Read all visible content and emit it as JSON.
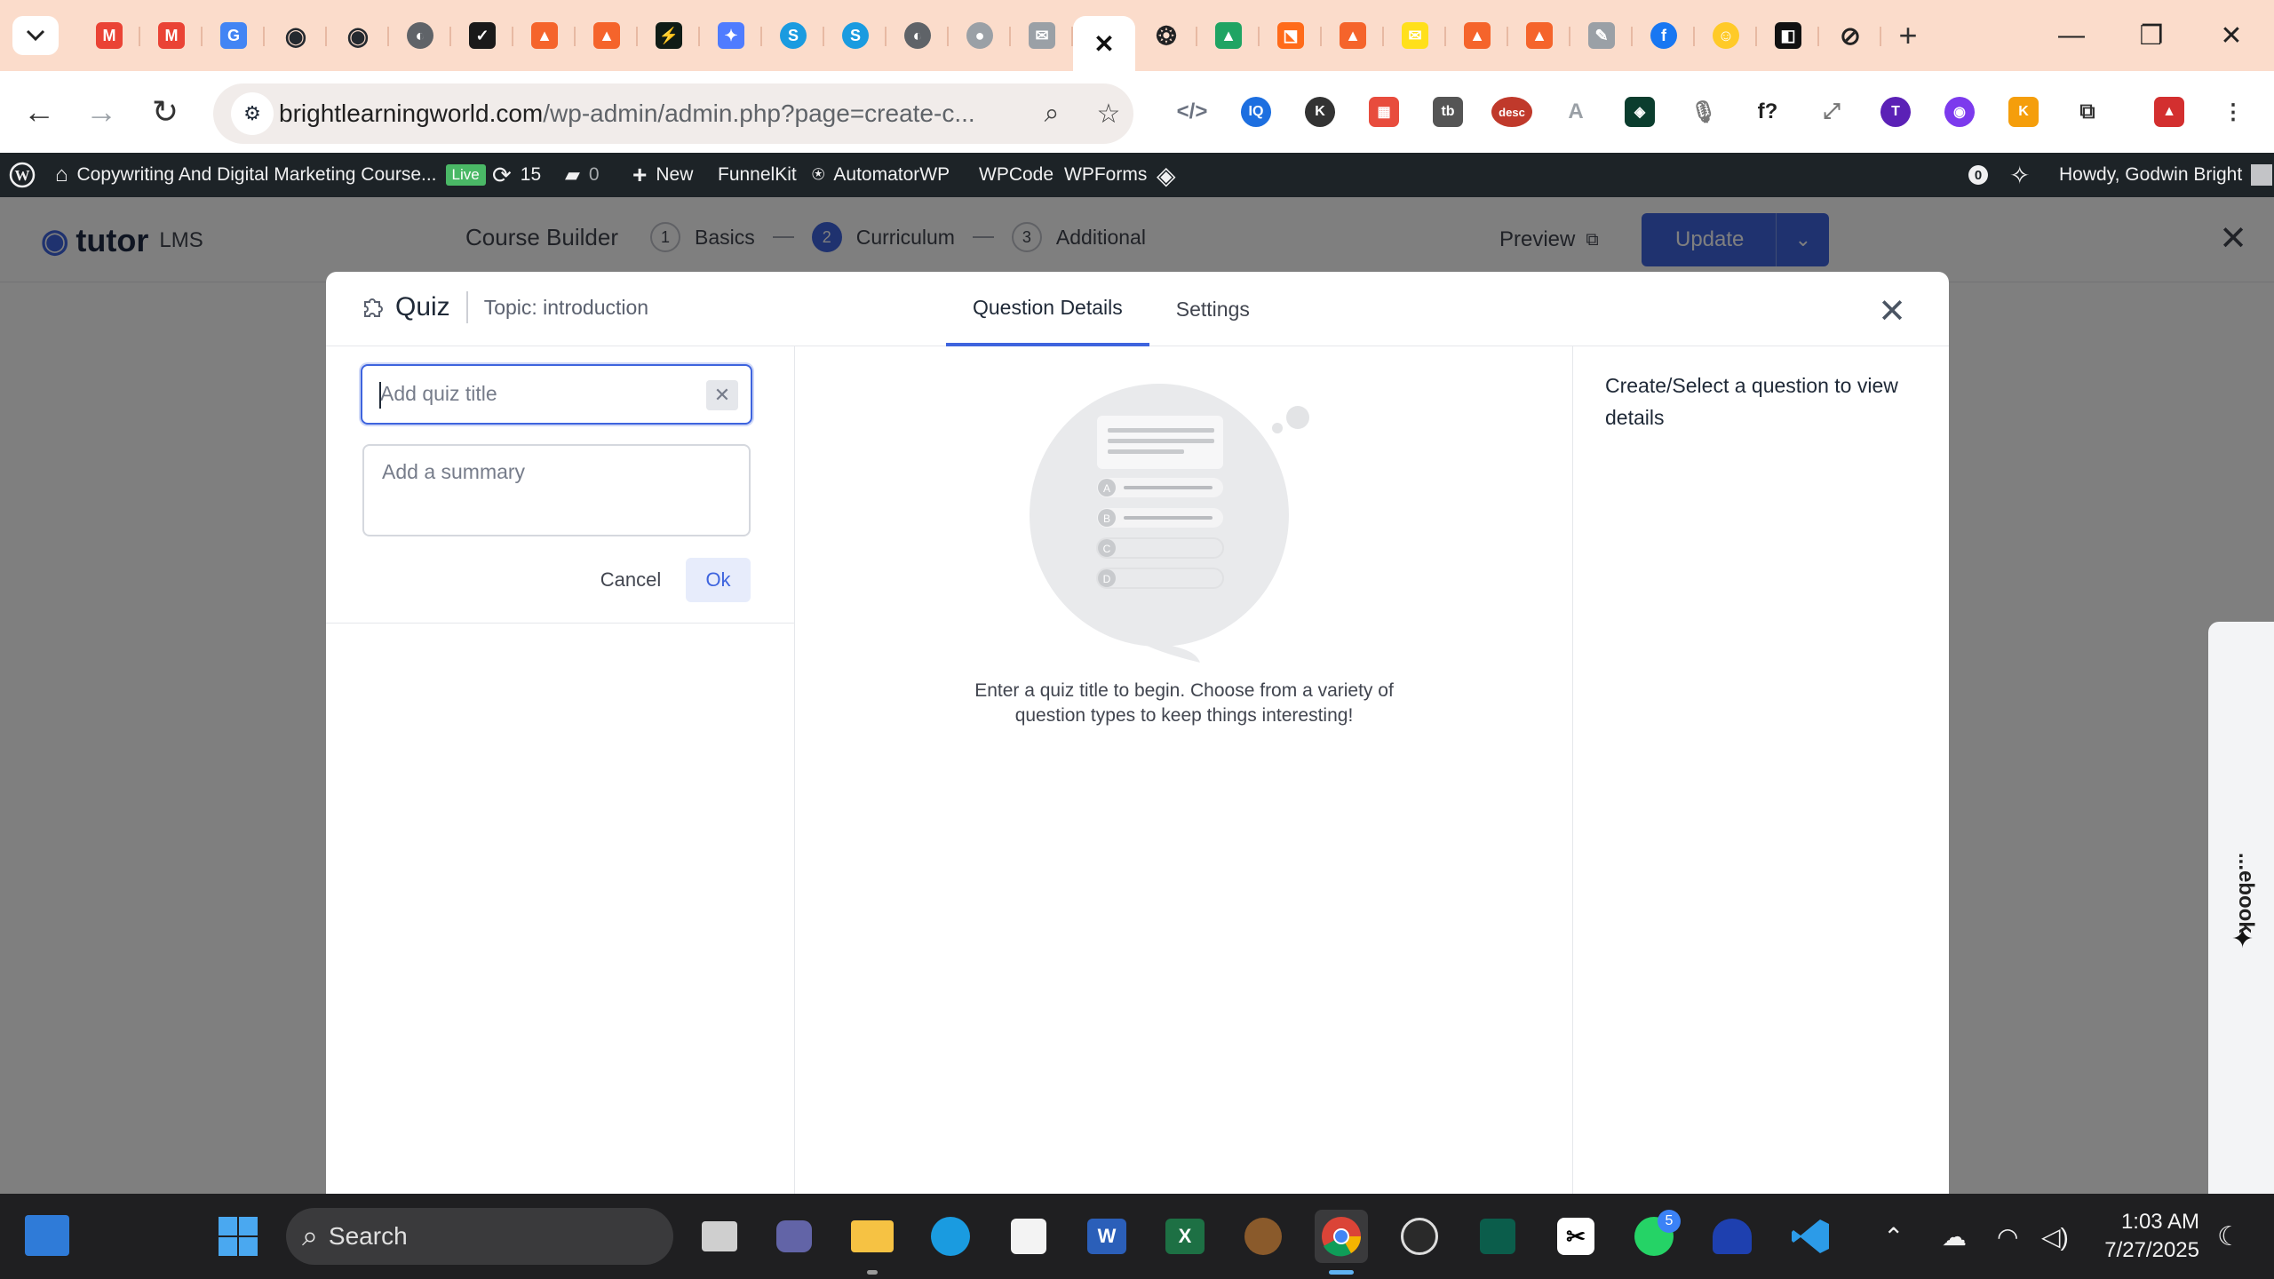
{
  "browser": {
    "tab_favicons": [
      {
        "name": "gmail-icon",
        "color": "#ea4335",
        "glyph": "M"
      },
      {
        "name": "gmail-icon",
        "color": "#ea4335",
        "glyph": "M"
      },
      {
        "name": "google-icon",
        "color": "#4285f4",
        "glyph": "G"
      },
      {
        "name": "github-icon",
        "color": "#24292f",
        "glyph": "◉"
      },
      {
        "name": "github-icon",
        "color": "#24292f",
        "glyph": "◉"
      },
      {
        "name": "globe-icon",
        "color": "#5f6368",
        "glyph": "◐"
      },
      {
        "name": "check-icon",
        "color": "#1a1a1a",
        "glyph": "✓"
      },
      {
        "name": "tab-app-icon",
        "color": "#f5642b",
        "glyph": "▲"
      },
      {
        "name": "tab-app-icon",
        "color": "#f5642b",
        "glyph": "▲"
      },
      {
        "name": "bolt-icon",
        "color": "#0f1c16",
        "glyph": "⚡"
      },
      {
        "name": "gemini-icon",
        "color": "#4f7cff",
        "glyph": "✦"
      },
      {
        "name": "skype-icon",
        "color": "#1a9be0",
        "glyph": "S"
      },
      {
        "name": "skype-icon",
        "color": "#1a9be0",
        "glyph": "S"
      },
      {
        "name": "globe-icon",
        "color": "#5f6368",
        "glyph": "◐"
      },
      {
        "name": "avatar-icon",
        "color": "#9aa0a6",
        "glyph": "●"
      },
      {
        "name": "mail-icon",
        "color": "#9aa0a6",
        "glyph": "✉"
      },
      {
        "name": "close-icon",
        "color": "#111111",
        "glyph": "✕"
      },
      {
        "name": "openai-icon",
        "color": "#202123",
        "glyph": "❂"
      },
      {
        "name": "drive-icon",
        "color": "#1fa463",
        "glyph": "▲"
      },
      {
        "name": "funnel-icon",
        "color": "#ff6b1a",
        "glyph": "⬔"
      },
      {
        "name": "tab-app-icon",
        "color": "#f5642b",
        "glyph": "▲"
      },
      {
        "name": "mailchimp-icon",
        "color": "#ffe01b",
        "glyph": "✉"
      },
      {
        "name": "tab-app-icon",
        "color": "#f5642b",
        "glyph": "▲"
      },
      {
        "name": "tab-app-icon",
        "color": "#f5642b",
        "glyph": "▲"
      },
      {
        "name": "pen-icon",
        "color": "#9aa0a6",
        "glyph": "✎"
      },
      {
        "name": "facebook-icon",
        "color": "#1877f2",
        "glyph": "f"
      },
      {
        "name": "emoji-icon",
        "color": "#ffca28",
        "glyph": "☺"
      },
      {
        "name": "capcut-icon",
        "color": "#111111",
        "glyph": "◧"
      },
      {
        "name": "slash-icon",
        "color": "#222222",
        "glyph": "⊘"
      }
    ],
    "url_host": "brightlearningworld.com",
    "url_path": "/wp-admin/admin.php?page=create-c...",
    "extension_icons": [
      {
        "name": "code-icon",
        "color": "#6b7280",
        "glyph": "</>"
      },
      {
        "name": "iq-icon",
        "color": "#1d6fe0",
        "glyph": "IQ"
      },
      {
        "name": "k-icon",
        "color": "#333333",
        "glyph": "K"
      },
      {
        "name": "colorgrid-icon",
        "color": "#e84c3d",
        "glyph": "▦"
      },
      {
        "name": "tb-icon",
        "color": "#555555",
        "glyph": "tb"
      },
      {
        "name": "descript-icon",
        "color": "#c0392b",
        "glyph": "desc"
      },
      {
        "name": "hanzi-icon",
        "color": "#9aa0a6",
        "glyph": "A"
      },
      {
        "name": "diamond-icon",
        "color": "#0b3d2e",
        "glyph": "◈"
      },
      {
        "name": "microphone-icon",
        "color": "#777777",
        "glyph": "🎙"
      },
      {
        "name": "function-icon",
        "color": "#222222",
        "glyph": "f?"
      },
      {
        "name": "expand-icon",
        "color": "#777777",
        "glyph": "⤢"
      },
      {
        "name": "t-icon",
        "color": "#5b21b6",
        "glyph": "T"
      },
      {
        "name": "eye-icon",
        "color": "#7c3aed",
        "glyph": "◉"
      },
      {
        "name": "k-badge-icon",
        "color": "#f59e0b",
        "glyph": "K"
      },
      {
        "name": "puzzle-icon",
        "color": "#333333",
        "glyph": "⧉"
      },
      {
        "name": "profile-icon",
        "color": "#d32f2f",
        "glyph": "▲"
      },
      {
        "name": "menu-icon",
        "color": "#333333",
        "glyph": "⋮"
      }
    ]
  },
  "wp_admin_bar": {
    "site_title": "Copywriting And Digital Marketing Course...",
    "live_badge": "Live",
    "updates_count": "15",
    "comments_count": "0",
    "new_label": "New",
    "menu_items": [
      "FunnelKit",
      "AutomatorWP",
      "WPCode",
      "WPForms"
    ],
    "notif_count": "0",
    "greeting": "Howdy, Godwin Bright"
  },
  "course_builder": {
    "logo_text": "tutor",
    "logo_suffix": "LMS",
    "title": "Course Builder",
    "steps": [
      {
        "num": "1",
        "label": "Basics"
      },
      {
        "num": "2",
        "label": "Curriculum"
      },
      {
        "num": "3",
        "label": "Additional"
      }
    ],
    "preview_label": "Preview",
    "update_label": "Update"
  },
  "quiz_modal": {
    "title": "Quiz",
    "topic": "Topic: introduction",
    "tabs": [
      "Question Details",
      "Settings"
    ],
    "title_placeholder": "Add quiz title",
    "summary_placeholder": "Add a summary",
    "cancel_label": "Cancel",
    "ok_label": "Ok",
    "option_letters": [
      "A",
      "B",
      "C",
      "D"
    ],
    "empty_message": "Enter a quiz title to begin. Choose from a variety of question types to keep things interesting!",
    "right_panel_message": "Create/Select a question to view details"
  },
  "side_panel": {
    "label": "...ebook"
  },
  "taskbar": {
    "search_label": "Search",
    "whatsapp_badge": "5",
    "time": "1:03 AM",
    "date": "7/27/2025"
  },
  "colors": {
    "accent": "#3e64de",
    "wp_bar": "#1d2327",
    "tab_strip": "#fbdccb"
  }
}
